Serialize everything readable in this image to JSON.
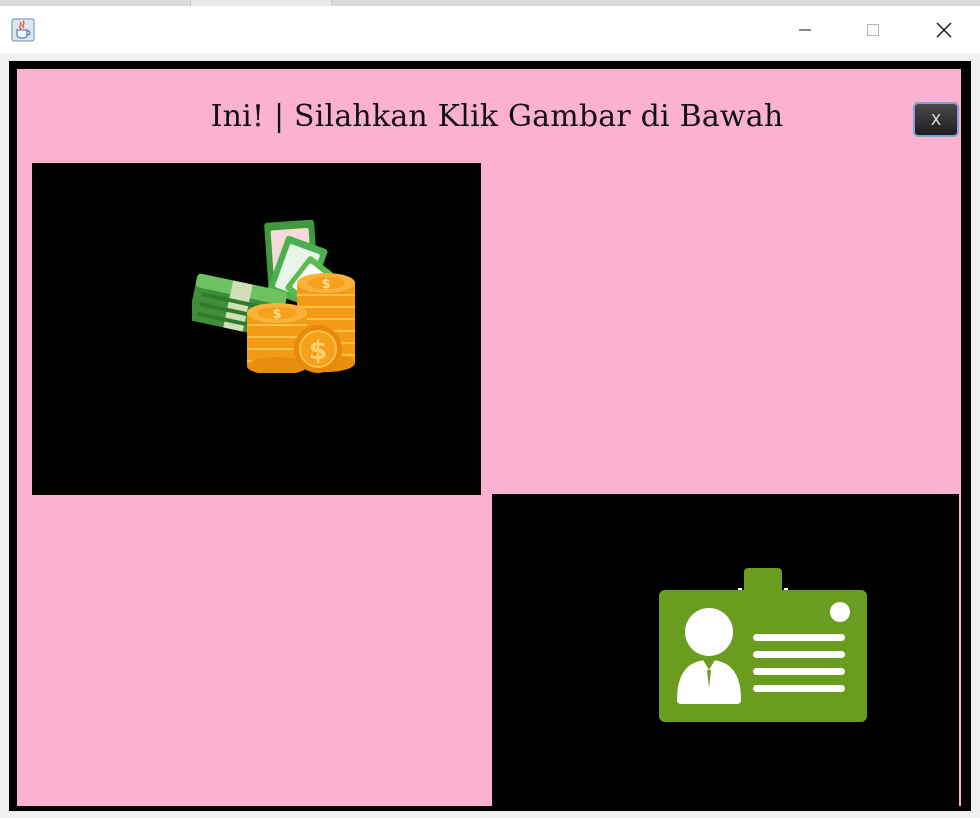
{
  "window": {
    "app_icon": "java-cup-icon",
    "controls": {
      "minimize_icon": "minimize-icon",
      "maximize_icon": "maximize-icon",
      "close_icon": "close-icon"
    }
  },
  "main": {
    "title": "Ini! | Silahkan Klik Gambar di Bawah",
    "close_button_label": "X",
    "background_color": "#fdb1d0",
    "panels": [
      {
        "icon": "money-coins-icon"
      },
      {
        "icon": "id-card-icon"
      }
    ]
  },
  "colors": {
    "panel_background": "#000000",
    "money_green": "#4caf50",
    "coin_orange": "#f7a21b",
    "id_card_green": "#6a9d1f"
  }
}
